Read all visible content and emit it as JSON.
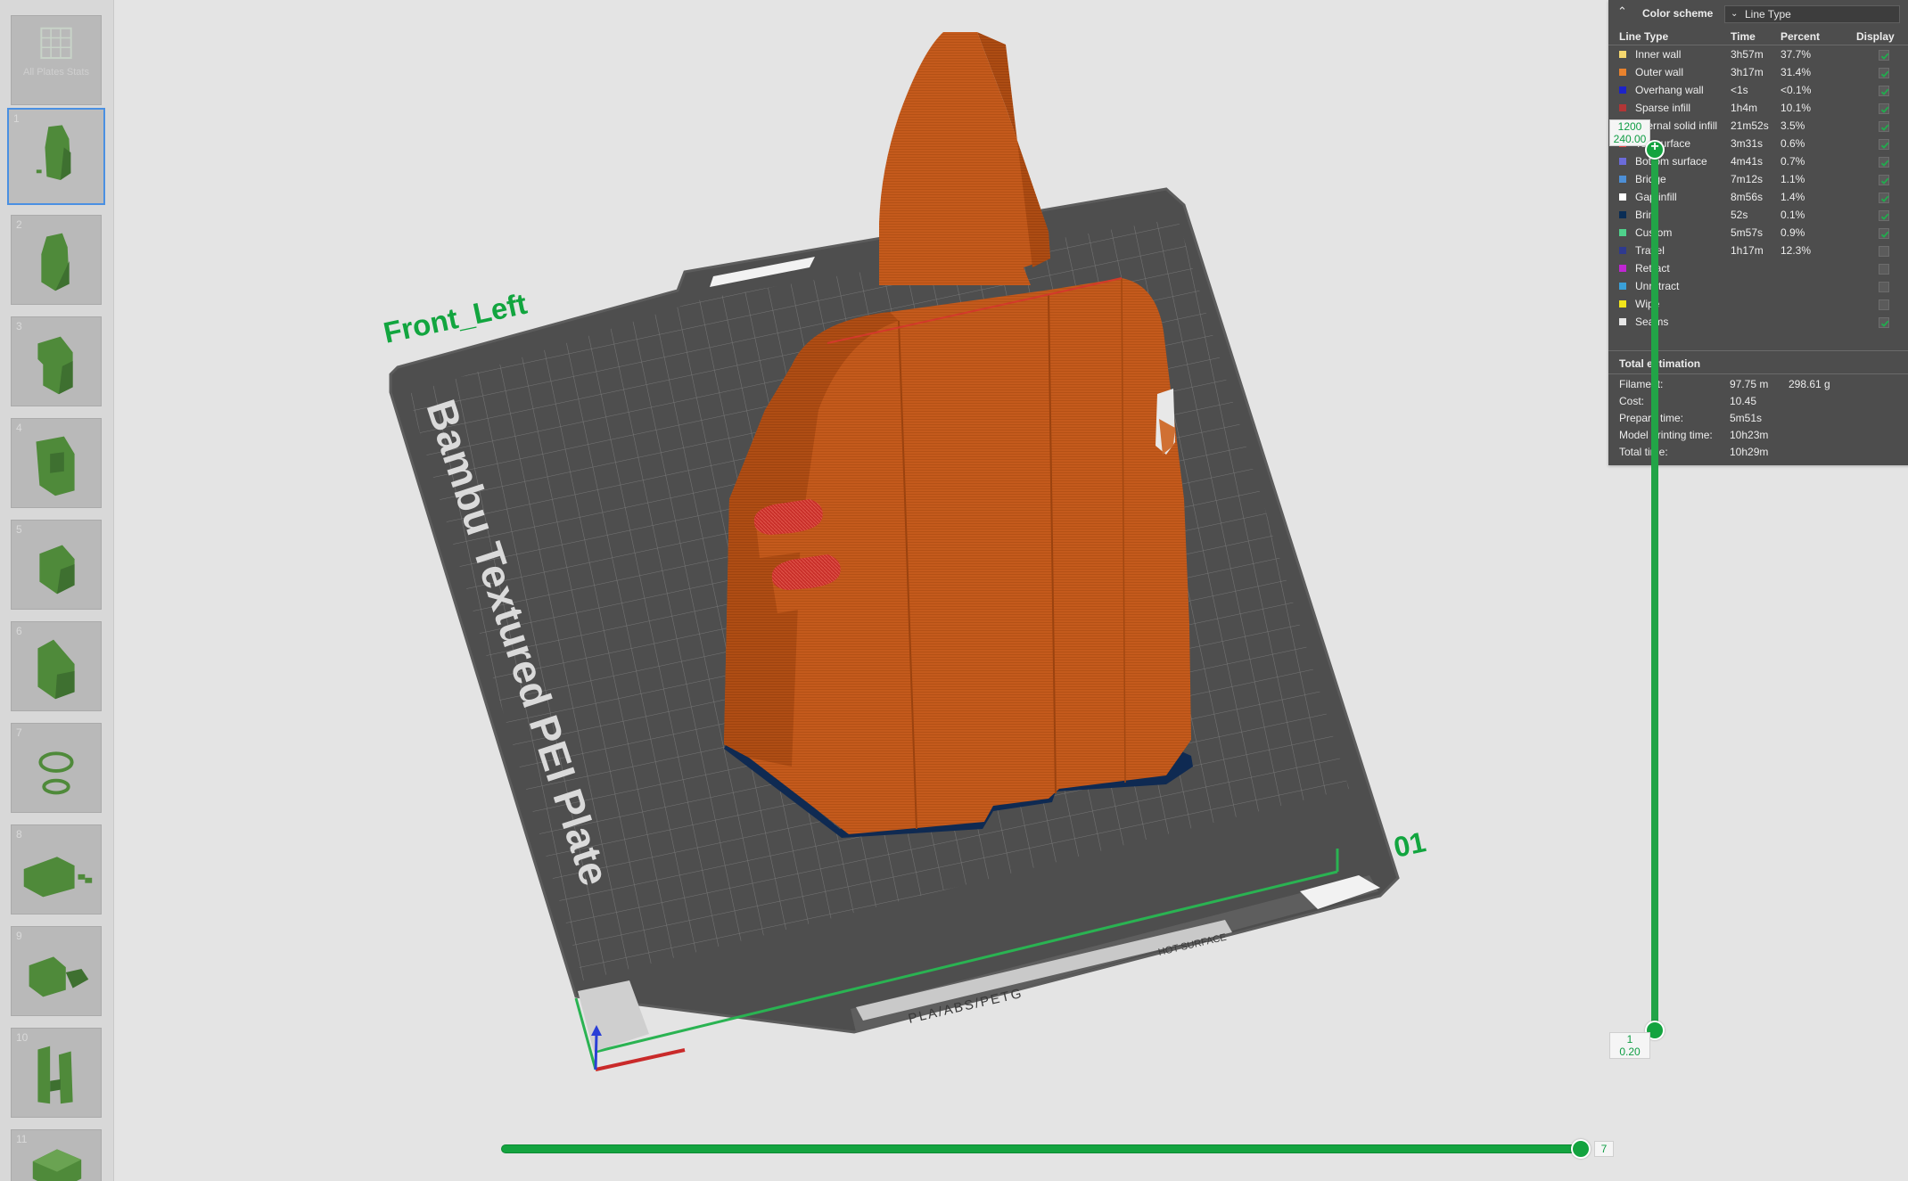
{
  "thumbnails": {
    "all_plates_label": "All Plates Stats",
    "plates": [
      "1",
      "2",
      "3",
      "4",
      "5",
      "6",
      "7",
      "8",
      "9",
      "10",
      "11"
    ],
    "selected_index": 0
  },
  "viewport": {
    "plate_name": "Front_Left",
    "plate_number": "01",
    "plate_type_text": "Bambu Textured PEI Plate",
    "edge_text_filament": "PLA/ABS/PETG",
    "edge_text_warning": "HOT SURFACE"
  },
  "legend": {
    "title": "Color scheme",
    "scheme_value": "Line Type",
    "columns": [
      "Line Type",
      "Time",
      "Percent",
      "Display"
    ],
    "rows": [
      {
        "name": "Inner wall",
        "time": "3h57m",
        "percent": "37.7%",
        "color": "#f5d76e",
        "display": true
      },
      {
        "name": "Outer wall",
        "time": "3h17m",
        "percent": "31.4%",
        "color": "#e8822d",
        "display": true
      },
      {
        "name": "Overhang wall",
        "time": "<1s",
        "percent": "<0.1%",
        "color": "#1d23c9",
        "display": true
      },
      {
        "name": "Sparse infill",
        "time": "1h4m",
        "percent": "10.1%",
        "color": "#b33636",
        "display": true
      },
      {
        "name": "Internal solid infill",
        "time": "21m52s",
        "percent": "3.5%",
        "color": "#a64dc7",
        "display": true
      },
      {
        "name": "Top surface",
        "time": "3m31s",
        "percent": "0.6%",
        "color": "#e64545",
        "display": true
      },
      {
        "name": "Bottom surface",
        "time": "4m41s",
        "percent": "0.7%",
        "color": "#6b6bd9",
        "display": true
      },
      {
        "name": "Bridge",
        "time": "7m12s",
        "percent": "1.1%",
        "color": "#4d8fd6",
        "display": true
      },
      {
        "name": "Gap infill",
        "time": "8m56s",
        "percent": "1.4%",
        "color": "#ffffff",
        "display": true
      },
      {
        "name": "Brim",
        "time": "52s",
        "percent": "0.1%",
        "color": "#0a2d55",
        "display": true
      },
      {
        "name": "Custom",
        "time": "5m57s",
        "percent": "0.9%",
        "color": "#4fd18b",
        "display": true
      },
      {
        "name": "Travel",
        "time": "1h17m",
        "percent": "12.3%",
        "color": "#2f3a8f",
        "display": false
      },
      {
        "name": "Retract",
        "time": "",
        "percent": "",
        "color": "#c026d3",
        "display": false
      },
      {
        "name": "Unretract",
        "time": "",
        "percent": "",
        "color": "#3aa0d8",
        "display": false
      },
      {
        "name": "Wipe",
        "time": "",
        "percent": "",
        "color": "#f2e51b",
        "display": false
      },
      {
        "name": "Seams",
        "time": "",
        "percent": "",
        "color": "#e6e6e6",
        "display": true
      }
    ],
    "total_title": "Total estimation",
    "filament_label": "Filament:",
    "filament_length": "97.75 m",
    "filament_weight": "298.61 g",
    "cost_label": "Cost:",
    "cost_value": "10.45",
    "prepare_label": "Prepare time:",
    "prepare_value": "5m51s",
    "model_print_label": "Model printing time:",
    "model_print_value": "10h23m",
    "total_label": "Total time:",
    "total_value": "10h29m"
  },
  "vertical_slider": {
    "top_layer": "1200",
    "top_height": "240.00",
    "bottom_layer": "1",
    "bottom_height": "0.20"
  },
  "horizontal_slider": {
    "value": "7",
    "position_fraction": 1.0
  },
  "colors": {
    "accent_green": "#13a33f",
    "model_orange": "#c45a1c",
    "plate_dark": "#4e4e4e",
    "panel_bg": "#4d4d4d"
  }
}
